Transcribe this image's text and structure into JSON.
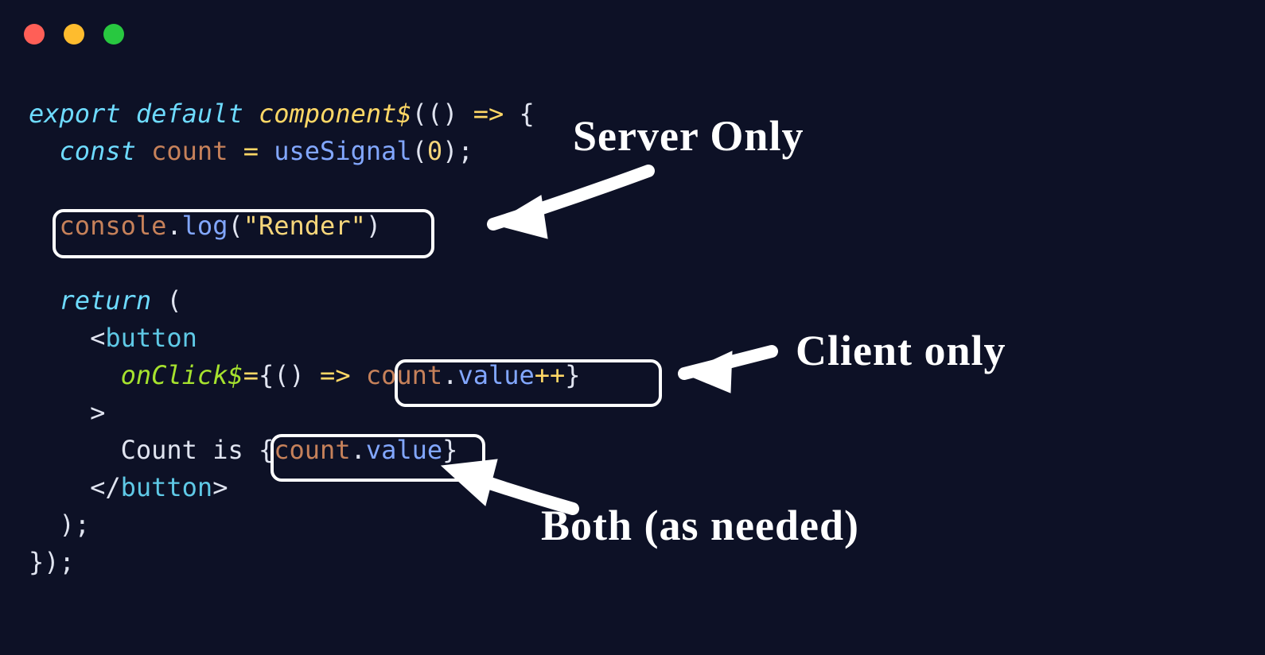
{
  "window": {
    "traffic_light_red": "red",
    "traffic_light_yellow": "yellow",
    "traffic_light_green": "green"
  },
  "code": {
    "l1_export": "export",
    "l1_default": "default",
    "l1_component": "component$",
    "l1_args": "(",
    "l1_paren": "()",
    "l1_arrow": " => ",
    "l1_brace": "{",
    "l2_const": "const",
    "l2_count": "count",
    "l2_eq": " = ",
    "l2_useSignal": "useSignal",
    "l2_open": "(",
    "l2_zero": "0",
    "l2_close": ");",
    "l4_console": "console",
    "l4_dot": ".",
    "l4_log": "log",
    "l4_open": "(",
    "l4_str": "\"Render\"",
    "l4_close": ")",
    "l6_return": "return",
    "l6_open": " (",
    "l7_open": "<",
    "l7_button": "button",
    "l8_onclick": "onClick$",
    "l8_eq": "=",
    "l8_bopen": "{",
    "l8_paren": "()",
    "l8_arrow": " => ",
    "l8_count": "count",
    "l8_dot": ".",
    "l8_value": "value",
    "l8_pp": "++",
    "l8_bclose": "}",
    "l9_gt": ">",
    "l10_text": "Count is ",
    "l10_open": "{",
    "l10_count": "count",
    "l10_dot": ".",
    "l10_value": "value",
    "l10_close": "}",
    "l11_open": "</",
    "l11_button": "button",
    "l11_close": ">",
    "l12": ");",
    "l13": "});"
  },
  "annotations": {
    "server_only": "Server Only",
    "client_only": "Client only",
    "both": "Both (as needed)"
  }
}
